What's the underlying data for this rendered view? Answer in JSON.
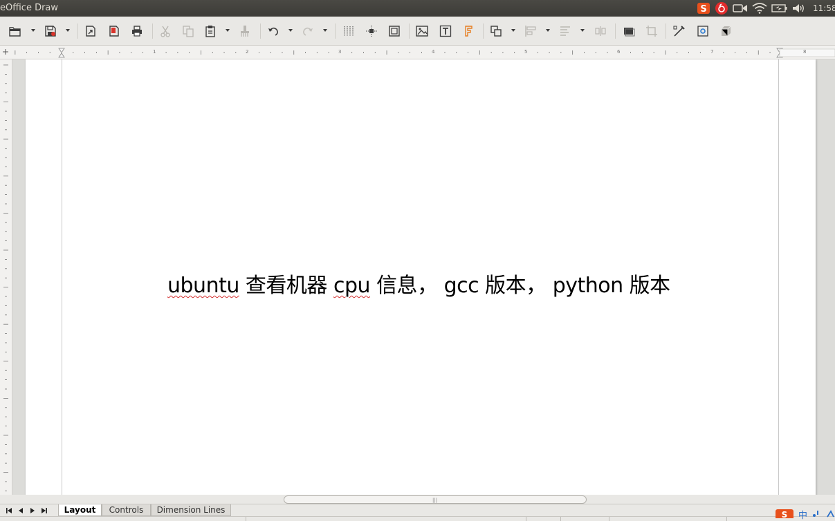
{
  "window": {
    "title": "eOffice Draw"
  },
  "tray": {
    "clock": "11:58",
    "items": [
      "sogou-ime-icon",
      "netease-music-icon",
      "camera-icon",
      "wifi-icon",
      "battery-icon",
      "volume-icon"
    ]
  },
  "toolbar": {
    "buttons": [
      "open",
      "save",
      "export-pdf-direct",
      "export",
      "print",
      "cut",
      "copy",
      "paste",
      "clone-formatting",
      "undo",
      "redo",
      "grid",
      "helplines",
      "zoom-pan",
      "insert-image",
      "insert-text",
      "fontwork",
      "transformations",
      "align",
      "arrange",
      "distribute",
      "shadow",
      "crop",
      "points",
      "glue-points",
      "toggle-extrusion"
    ]
  },
  "ruler": {
    "labels": [
      "1",
      "2",
      "3",
      "4",
      "5",
      "6",
      "7",
      "8"
    ]
  },
  "document": {
    "text_parts": [
      "ubuntu",
      " 查看机器 ",
      "cpu",
      " 信息， gcc 版本， python 版本"
    ]
  },
  "tabs": [
    {
      "label": "Layout",
      "active": true
    },
    {
      "label": "Controls",
      "active": false
    },
    {
      "label": "Dimension Lines",
      "active": false
    }
  ],
  "ime": {
    "label": "中"
  }
}
